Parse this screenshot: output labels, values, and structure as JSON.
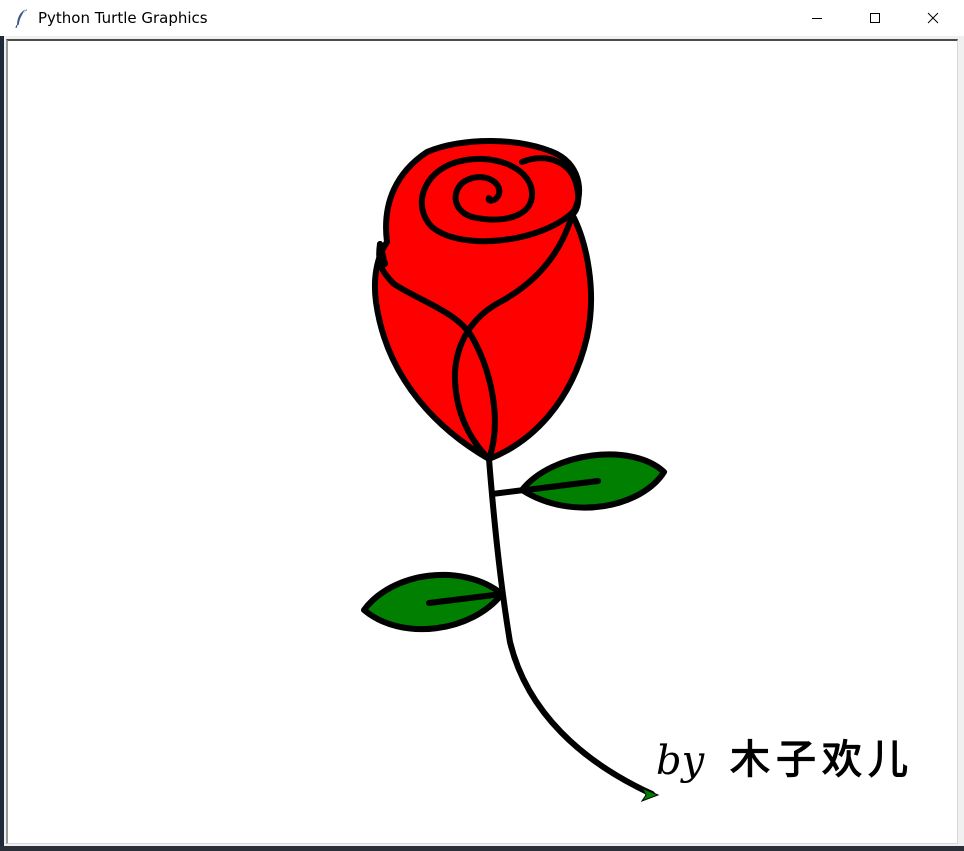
{
  "window": {
    "title": "Python Turtle Graphics",
    "icon": "feather-icon",
    "controls": {
      "minimize": "minimize-icon",
      "maximize": "maximize-icon",
      "close": "close-icon"
    }
  },
  "canvas": {
    "signature_by": "by",
    "signature_name": "木子欢儿",
    "colors": {
      "petal": "#ff0000",
      "leaf": "#007f00",
      "outline": "#000000",
      "turtle": "#008000",
      "background": "#ffffff"
    }
  }
}
